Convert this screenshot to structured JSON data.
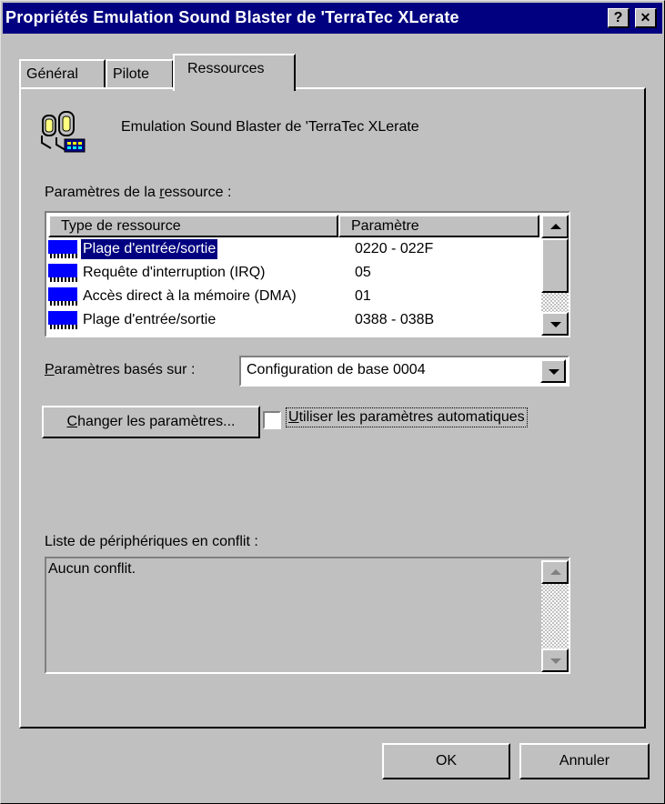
{
  "window": {
    "title": "Propriétés Emulation Sound Blaster de 'TerraTec XLerate",
    "help_button": "?",
    "close_button": "✕"
  },
  "tabs": [
    {
      "label": "Général",
      "active": false
    },
    {
      "label": "Pilote",
      "active": false
    },
    {
      "label": "Ressources",
      "active": true
    }
  ],
  "device": {
    "icon": "sound-device-icon",
    "name": "Emulation Sound Blaster de 'TerraTec XLerate"
  },
  "resources": {
    "label_pre": "Paramètres de la ",
    "label_accel": "r",
    "label_post": "essource :",
    "columns": [
      "Type de ressource",
      "Paramètre"
    ],
    "rows": [
      {
        "type": "Plage d'entrée/sortie",
        "setting": "0220 - 022F",
        "selected": true
      },
      {
        "type": "Requête d'interruption (IRQ)",
        "setting": "05",
        "selected": false
      },
      {
        "type": "Accès direct à la mémoire (DMA)",
        "setting": "01",
        "selected": false
      },
      {
        "type": "Plage d'entrée/sortie",
        "setting": "0388 - 038B",
        "selected": false
      }
    ]
  },
  "based_on": {
    "label_accel": "P",
    "label_post": "aramètres basés sur :",
    "value": "Configuration de base 0004"
  },
  "change_button": {
    "label_accel": "C",
    "label_post": "hanger les paramètres..."
  },
  "auto_checkbox": {
    "label_accel": "U",
    "label_post": "tiliser les paramètres automatiques",
    "checked": false
  },
  "conflicts": {
    "label": "Liste de périphériques en conflit :",
    "text": "Aucun conflit."
  },
  "footer": {
    "ok": "OK",
    "cancel": "Annuler"
  },
  "colors": {
    "title_bar": "#000080",
    "face": "#c0c0c0",
    "selection": "#000080",
    "resource_icon": "#0000ff"
  }
}
